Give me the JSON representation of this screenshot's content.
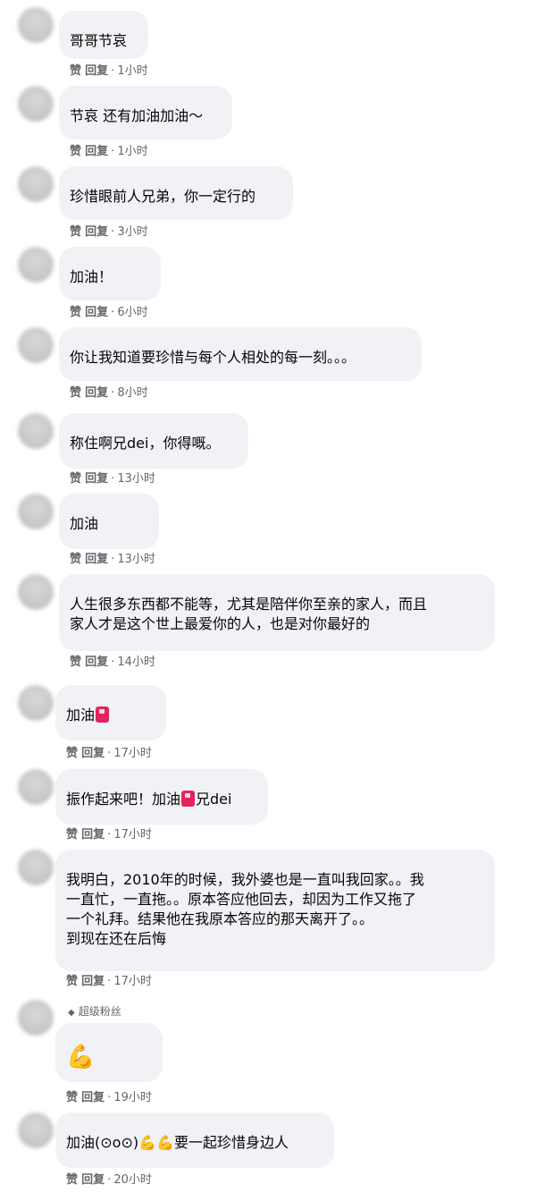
{
  "actions": {
    "like": "赞",
    "reply": "回复",
    "sep": "·"
  },
  "fan_badge": "超级粉丝",
  "comments": [
    {
      "text": "哥哥节哀",
      "time": "1小时"
    },
    {
      "text": "节哀 还有加油加油～",
      "time": "1小时"
    },
    {
      "text": "珍惜眼前人兄弟，你一定行的",
      "time": "3小时"
    },
    {
      "text": "加油！",
      "time": "6小时"
    },
    {
      "text": "你让我知道要珍惜与每个人相处的每一刻。。。",
      "time": "8小时"
    },
    {
      "text": "称住啊兄dei，你得嘅。",
      "time": "13小时"
    },
    {
      "text": "加油",
      "time": "13小时"
    },
    {
      "text": "人生很多东西都不能等，尤其是陪伴你至亲的家人，而且\n家人才是这个世上最爱你的人，也是对你最好的",
      "time": "14小时"
    },
    {
      "text": "加油",
      "time": "17小时"
    },
    {
      "text_a": "振作起来吧！加油",
      "text_b": "兄dei",
      "time": "17小时"
    },
    {
      "text": "我明白，2010年的时候，我外婆也是一直叫我回家。。我\n一直忙，一直拖。。原本答应他回去，却因为工作又拖了\n一个礼拜。结果他在我原本答应的那天离开了。。\n到现在还在后悔",
      "time": "17小时"
    },
    {
      "emoji": "💪",
      "time": "19小时"
    },
    {
      "text_a": "加油(⊙o⊙)",
      "emoji": "💪💪",
      "text_b": "要一起珍惜身边人",
      "time": "20小时"
    }
  ]
}
